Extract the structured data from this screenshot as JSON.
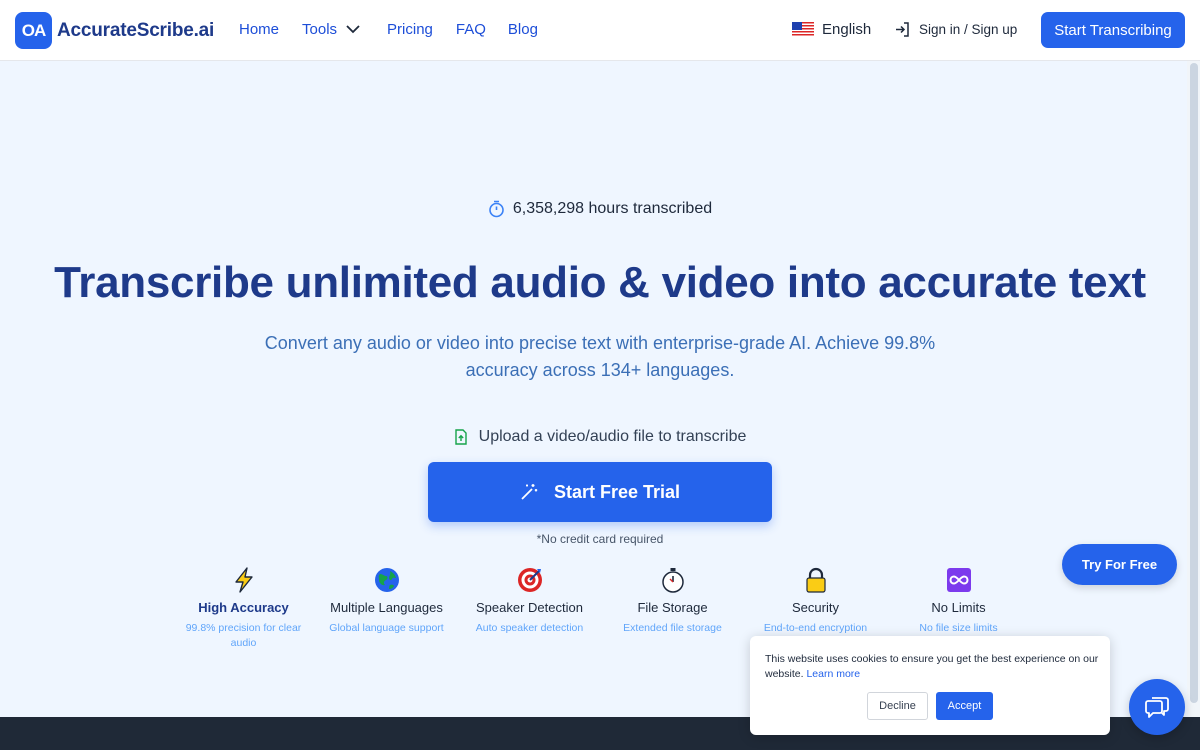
{
  "brand": {
    "name": "AccurateScribe.ai",
    "logo_mark": "OA"
  },
  "nav": {
    "home": "Home",
    "tools": "Tools",
    "pricing": "Pricing",
    "faq": "FAQ",
    "blog": "Blog"
  },
  "header": {
    "language": "English",
    "signin": "Sign in / Sign up",
    "cta": "Start Transcribing"
  },
  "hero": {
    "hours": "6,358,298 hours transcribed",
    "headline": "Transcribe unlimited audio & video into accurate text",
    "subtitle": "Convert any audio or video into precise text with enterprise-grade AI. Achieve 99.8% accuracy across 134+ languages.",
    "upload_label": "Upload a video/audio file to transcribe",
    "trial_button": "Start Free Trial",
    "no_card": "*No credit card required"
  },
  "features": [
    {
      "title": "High Accuracy",
      "desc": "99.8% precision for clear audio",
      "icon": "lightning-icon"
    },
    {
      "title": "Multiple Languages",
      "desc": "Global language support",
      "icon": "globe-icon"
    },
    {
      "title": "Speaker Detection",
      "desc": "Auto speaker detection",
      "icon": "target-icon"
    },
    {
      "title": "File Storage",
      "desc": "Extended file storage",
      "icon": "stopwatch-icon"
    },
    {
      "title": "Security",
      "desc": "End-to-end encryption",
      "icon": "lock-icon"
    },
    {
      "title": "No Limits",
      "desc": "No file size limits",
      "icon": "infinity-icon"
    }
  ],
  "floating": {
    "try_free": "Try For Free"
  },
  "cookie": {
    "text": "This website uses cookies to ensure you get the best experience on our website.",
    "link": "Learn more",
    "decline": "Decline",
    "accept": "Accept"
  },
  "colors": {
    "primary": "#2563eb",
    "heading": "#1e3a8a",
    "background": "#eff6ff",
    "footer": "#1f2937"
  }
}
